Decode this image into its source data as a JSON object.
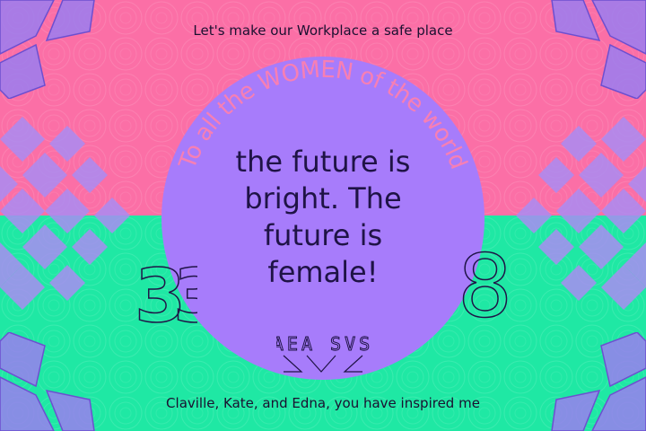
{
  "card": {
    "colors": {
      "top_background": "#fb6fa6",
      "bottom_background": "#1fe8a4",
      "circle": "#a77cfb",
      "ink": "#1f1346",
      "accent_purple": "#9a7ef0"
    },
    "top_tagline": "Let's make our Workplace a safe place",
    "arc_text": "To all the WOMEN of the world",
    "headline_lines": [
      "the future is",
      "bright. The",
      "future is",
      "female!"
    ],
    "left_ornament": "33",
    "right_ornament": "8",
    "center_ornament": "AEA SVS",
    "bottom_tagline": "Claville, Kate, and Edna, you have inspired me"
  }
}
